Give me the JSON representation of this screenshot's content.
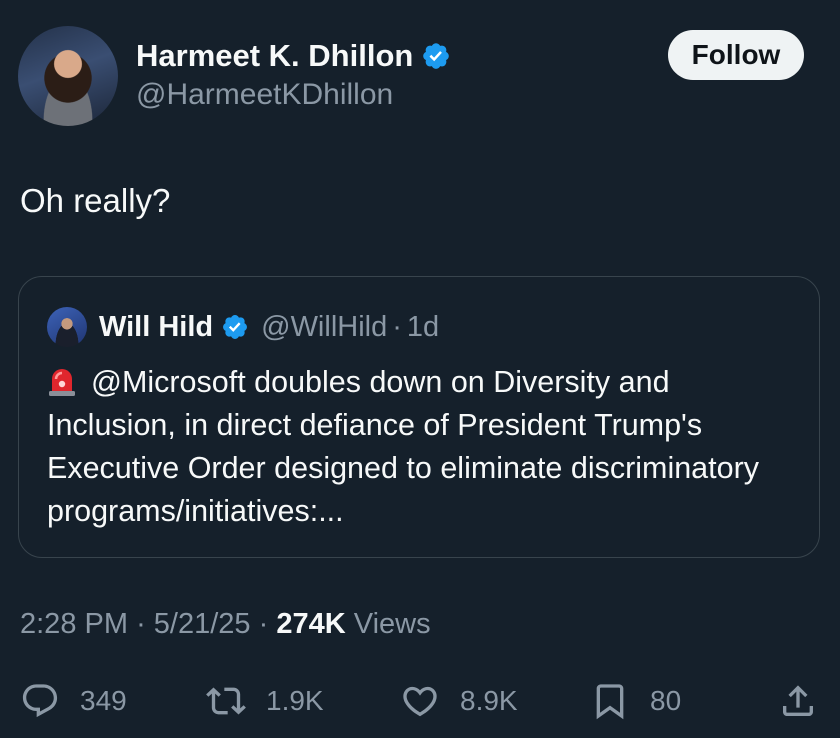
{
  "author": {
    "name": "Harmeet K. Dhillon",
    "handle": "@HarmeetKDhillon"
  },
  "follow_label": "Follow",
  "tweet_text": "Oh really?",
  "quoted": {
    "name": "Will Hild",
    "handle": "@WillHild",
    "separator": "·",
    "time": "1d",
    "text": "@Microsoft doubles down on Diversity and Inclusion, in direct defiance of President Trump's Executive Order designed to eliminate discriminatory programs/initiatives:..."
  },
  "meta": {
    "time": "2:28 PM",
    "separator": "·",
    "date": "5/21/25",
    "views_count": "274K",
    "views_label": "Views"
  },
  "actions": {
    "replies": "349",
    "reposts": "1.9K",
    "likes": "8.9K",
    "bookmarks": "80"
  },
  "colors": {
    "background": "#15202b",
    "text_primary": "#f7f9f9",
    "text_secondary": "#8b98a5",
    "verified_badge": "#1d9bf0",
    "border": "#38444d"
  },
  "icons": {
    "verified": "verified-badge-icon",
    "siren": "rotating-light-emoji-icon",
    "reply": "reply-icon",
    "repost": "repost-icon",
    "like": "heart-icon",
    "bookmark": "bookmark-icon",
    "share": "share-icon"
  }
}
